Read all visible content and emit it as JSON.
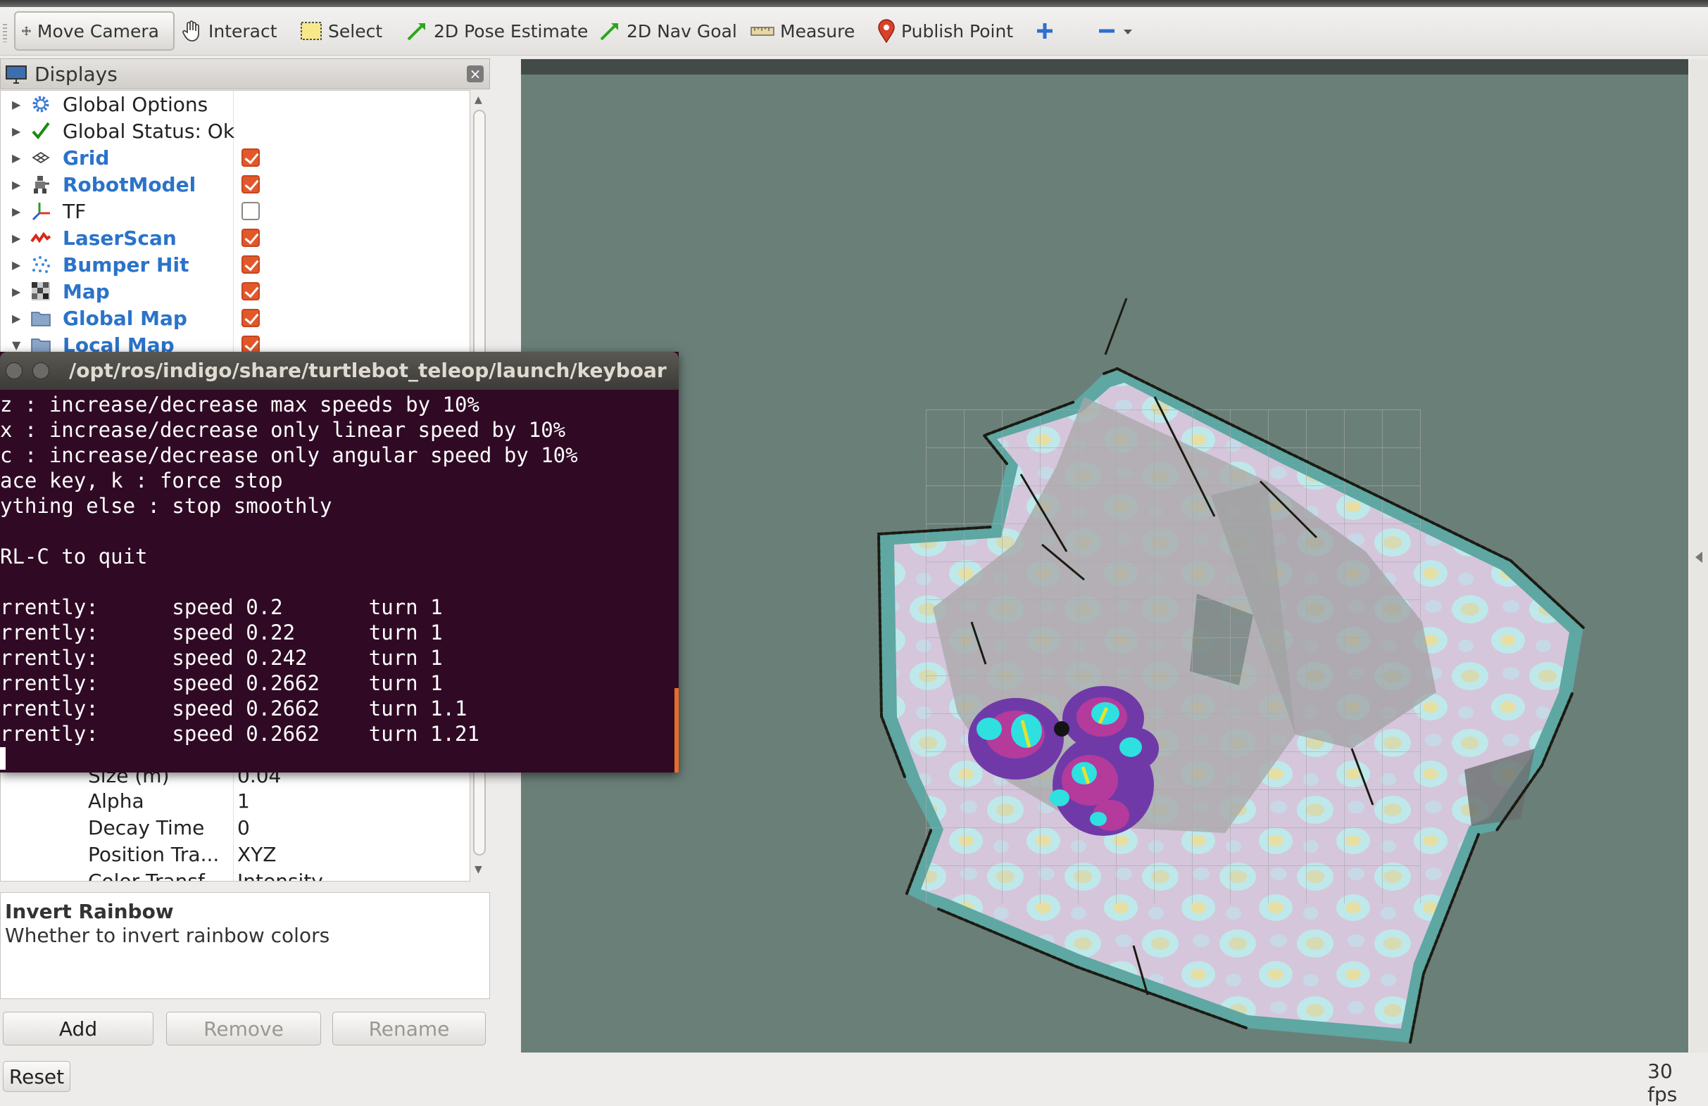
{
  "toolbar": {
    "move_camera": "Move Camera",
    "interact": "Interact",
    "select": "Select",
    "pose_estimate": "2D Pose Estimate",
    "nav_goal": "2D Nav Goal",
    "measure": "Measure",
    "publish_point": "Publish Point"
  },
  "displays": {
    "title": "Displays",
    "items": [
      {
        "label": "Global Options",
        "checked": null
      },
      {
        "label": "Global Status: Ok",
        "checked": null
      },
      {
        "label": "Grid",
        "checked": true
      },
      {
        "label": "RobotModel",
        "checked": true
      },
      {
        "label": "TF",
        "checked": false
      },
      {
        "label": "LaserScan",
        "checked": true
      },
      {
        "label": "Bumper Hit",
        "checked": true
      },
      {
        "label": "Map",
        "checked": true
      },
      {
        "label": "Global Map",
        "checked": true
      },
      {
        "label": "Local Map",
        "checked": true
      }
    ],
    "props": [
      {
        "name": "Size (m)",
        "value": "0.04"
      },
      {
        "name": "Alpha",
        "value": "1"
      },
      {
        "name": "Decay Time",
        "value": "0"
      },
      {
        "name": "Position Tra...",
        "value": "XYZ"
      },
      {
        "name": "Color Transf...",
        "value": "Intensity"
      }
    ]
  },
  "help": {
    "heading": "Invert Rainbow",
    "description": "Whether to invert rainbow colors"
  },
  "buttons": {
    "add": "Add",
    "remove": "Remove",
    "rename": "Rename",
    "reset": "Reset"
  },
  "status": {
    "fps": "30 fps"
  },
  "terminal": {
    "title": "/opt/ros/indigo/share/turtlebot_teleop/launch/keyboard_te",
    "lines": [
      "z : increase/decrease max speeds by 10%",
      "x : increase/decrease only linear speed by 10%",
      "c : increase/decrease only angular speed by 10%",
      "ace key, k : force stop",
      "ything else : stop smoothly",
      "",
      "RL-C to quit",
      "",
      "rrently:      speed 0.2       turn 1",
      "rrently:      speed 0.22      turn 1",
      "rrently:      speed 0.242     turn 1",
      "rrently:      speed 0.2662    turn 1",
      "rrently:      speed 0.2662    turn 1.1",
      "rrently:      speed 0.2662    turn 1.21"
    ]
  },
  "colors": {
    "terminal_bg": "#300a24",
    "viewport_bg": "#6b7f79",
    "checkbox_on": "#e2582b",
    "display_label_blue": "#2b73c9"
  }
}
